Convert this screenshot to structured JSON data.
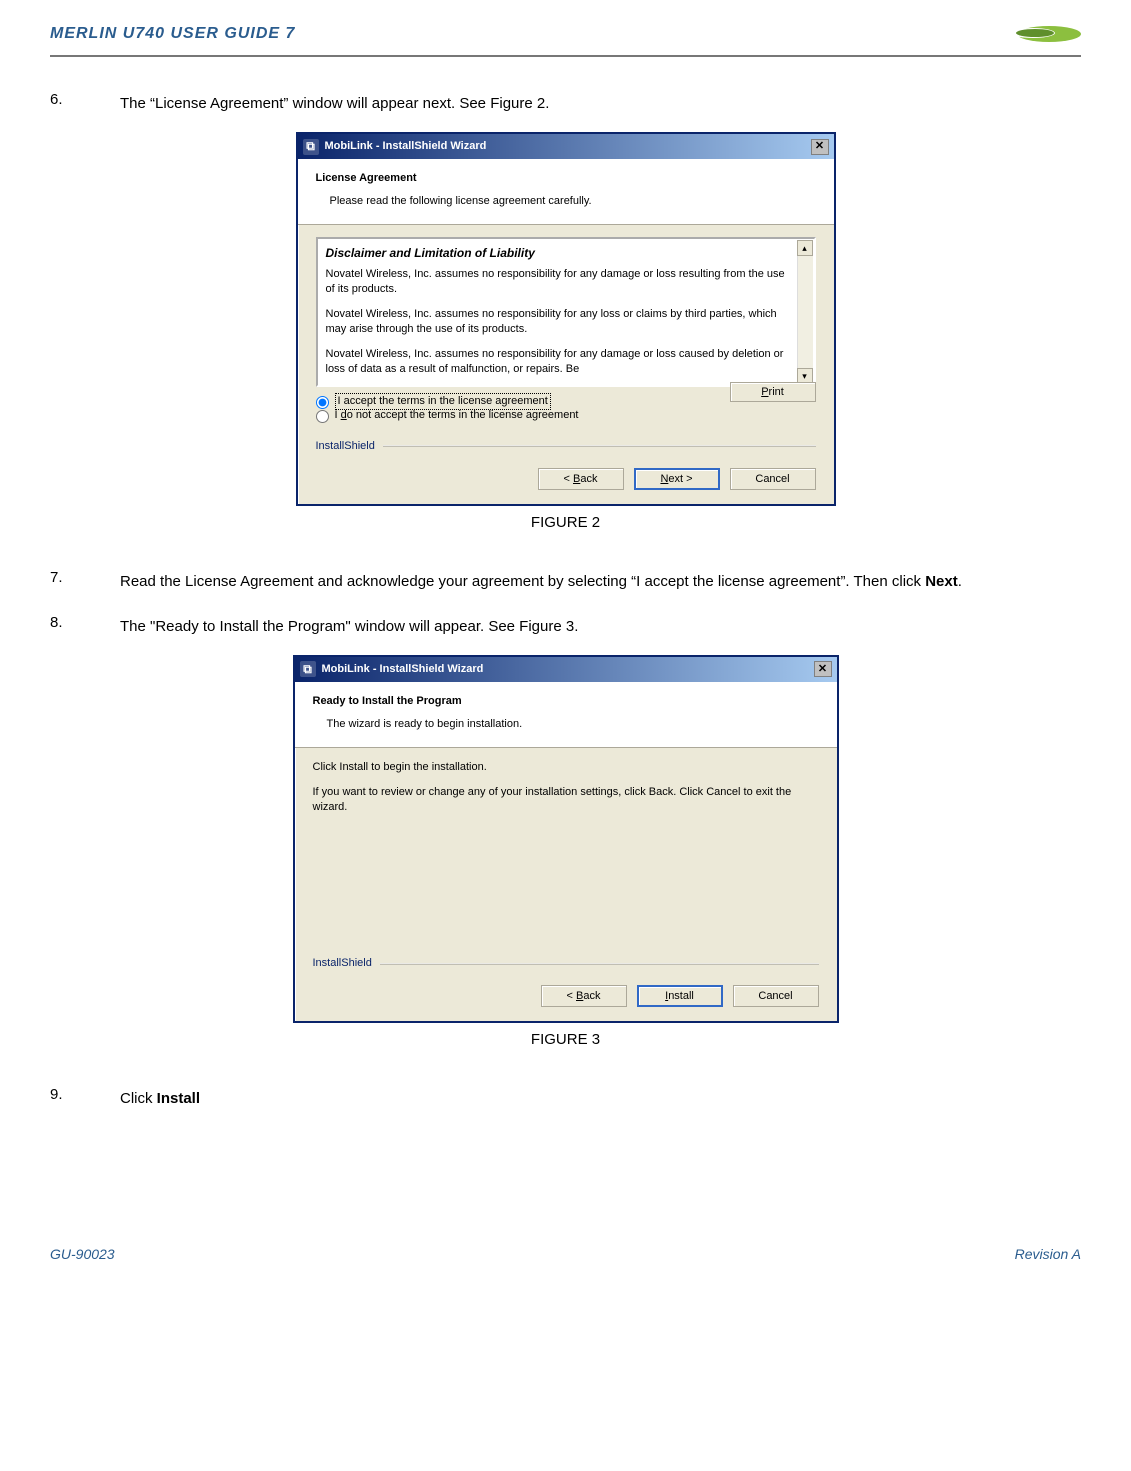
{
  "header": {
    "title": "MERLIN U740 USER GUIDE 7",
    "logo_alt": "logo"
  },
  "steps": {
    "s6": {
      "num": "6.",
      "text": "The “License Agreement” window will appear next.  See Figure 2."
    },
    "s7": {
      "num": "7.",
      "text_pre": "Read the License Agreement and acknowledge your agreement by selecting “I accept the license agreement”.  Then click ",
      "bold": "Next",
      "text_post": "."
    },
    "s8": {
      "num": "8.",
      "text": "The \"Ready to Install the Program\" window will appear.  See Figure 3."
    },
    "s9": {
      "num": "9.",
      "text_pre": "Click ",
      "bold": "Install"
    }
  },
  "figures": {
    "f2_label": "FIGURE 2",
    "f3_label": "FIGURE 3"
  },
  "dialog1": {
    "title": "MobiLink - InstallShield Wizard",
    "banner_title": "License Agreement",
    "banner_sub": "Please read the following license agreement carefully.",
    "disclaimer_heading": "Disclaimer and Limitation of Liability",
    "para1": "Novatel Wireless, Inc. assumes no responsibility for any damage or loss resulting from the use of its products.",
    "para2": "Novatel Wireless, Inc. assumes no responsibility for any loss or claims by third parties, which may arise through the use of its products.",
    "para3": "Novatel Wireless, Inc. assumes no responsibility for any damage or loss caused by deletion or loss of data as a result of malfunction, or repairs.  Be",
    "radio_accept_pre": "I accept the terms in the license agreement",
    "radio_decline_pre": "I ",
    "radio_decline_u": "d",
    "radio_decline_post": "o not accept the terms in the license agreement",
    "print_label": "Print",
    "print_u": "P",
    "brand": "InstallShield",
    "back_label": "< Back",
    "back_u": "B",
    "next_label": "Next >",
    "next_u": "N",
    "cancel_label": "Cancel"
  },
  "dialog2": {
    "title": "MobiLink - InstallShield Wizard",
    "banner_title": "Ready to Install the Program",
    "banner_sub": "The wizard is ready to begin installation.",
    "line1": "Click Install to begin the installation.",
    "line2": "If you want to review or change any of your installation settings, click Back. Click Cancel to exit the wizard.",
    "brand": "InstallShield",
    "back_label": "< Back",
    "back_u": "B",
    "install_label": "Install",
    "install_u": "I",
    "cancel_label": "Cancel"
  },
  "footer": {
    "left": "GU-90023",
    "right": "Revision A"
  }
}
